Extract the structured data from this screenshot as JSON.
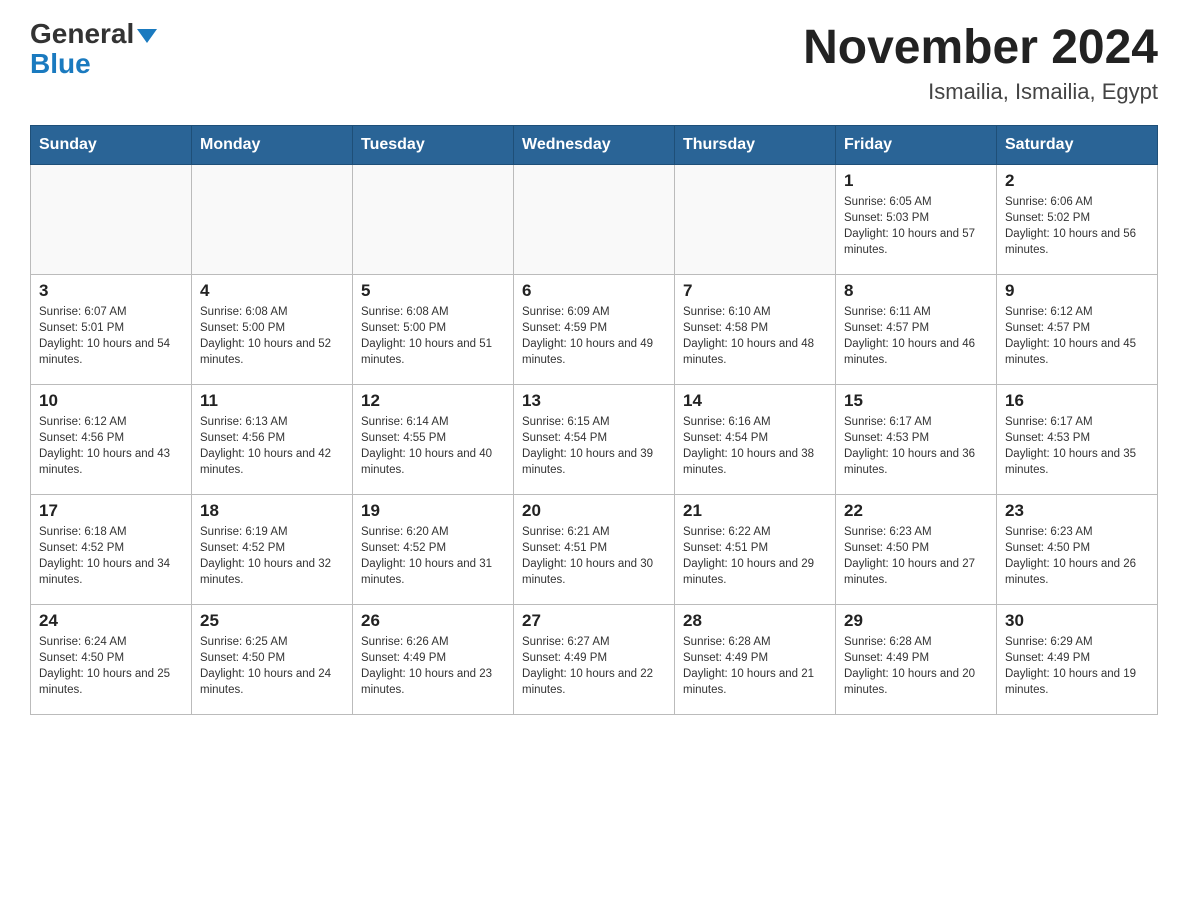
{
  "header": {
    "logo": {
      "general": "General",
      "triangle": "▶",
      "blue": "Blue"
    },
    "title": "November 2024",
    "subtitle": "Ismailia, Ismailia, Egypt"
  },
  "days_of_week": [
    "Sunday",
    "Monday",
    "Tuesday",
    "Wednesday",
    "Thursday",
    "Friday",
    "Saturday"
  ],
  "weeks": [
    [
      {
        "day": "",
        "info": ""
      },
      {
        "day": "",
        "info": ""
      },
      {
        "day": "",
        "info": ""
      },
      {
        "day": "",
        "info": ""
      },
      {
        "day": "",
        "info": ""
      },
      {
        "day": "1",
        "info": "Sunrise: 6:05 AM\nSunset: 5:03 PM\nDaylight: 10 hours and 57 minutes."
      },
      {
        "day": "2",
        "info": "Sunrise: 6:06 AM\nSunset: 5:02 PM\nDaylight: 10 hours and 56 minutes."
      }
    ],
    [
      {
        "day": "3",
        "info": "Sunrise: 6:07 AM\nSunset: 5:01 PM\nDaylight: 10 hours and 54 minutes."
      },
      {
        "day": "4",
        "info": "Sunrise: 6:08 AM\nSunset: 5:00 PM\nDaylight: 10 hours and 52 minutes."
      },
      {
        "day": "5",
        "info": "Sunrise: 6:08 AM\nSunset: 5:00 PM\nDaylight: 10 hours and 51 minutes."
      },
      {
        "day": "6",
        "info": "Sunrise: 6:09 AM\nSunset: 4:59 PM\nDaylight: 10 hours and 49 minutes."
      },
      {
        "day": "7",
        "info": "Sunrise: 6:10 AM\nSunset: 4:58 PM\nDaylight: 10 hours and 48 minutes."
      },
      {
        "day": "8",
        "info": "Sunrise: 6:11 AM\nSunset: 4:57 PM\nDaylight: 10 hours and 46 minutes."
      },
      {
        "day": "9",
        "info": "Sunrise: 6:12 AM\nSunset: 4:57 PM\nDaylight: 10 hours and 45 minutes."
      }
    ],
    [
      {
        "day": "10",
        "info": "Sunrise: 6:12 AM\nSunset: 4:56 PM\nDaylight: 10 hours and 43 minutes."
      },
      {
        "day": "11",
        "info": "Sunrise: 6:13 AM\nSunset: 4:56 PM\nDaylight: 10 hours and 42 minutes."
      },
      {
        "day": "12",
        "info": "Sunrise: 6:14 AM\nSunset: 4:55 PM\nDaylight: 10 hours and 40 minutes."
      },
      {
        "day": "13",
        "info": "Sunrise: 6:15 AM\nSunset: 4:54 PM\nDaylight: 10 hours and 39 minutes."
      },
      {
        "day": "14",
        "info": "Sunrise: 6:16 AM\nSunset: 4:54 PM\nDaylight: 10 hours and 38 minutes."
      },
      {
        "day": "15",
        "info": "Sunrise: 6:17 AM\nSunset: 4:53 PM\nDaylight: 10 hours and 36 minutes."
      },
      {
        "day": "16",
        "info": "Sunrise: 6:17 AM\nSunset: 4:53 PM\nDaylight: 10 hours and 35 minutes."
      }
    ],
    [
      {
        "day": "17",
        "info": "Sunrise: 6:18 AM\nSunset: 4:52 PM\nDaylight: 10 hours and 34 minutes."
      },
      {
        "day": "18",
        "info": "Sunrise: 6:19 AM\nSunset: 4:52 PM\nDaylight: 10 hours and 32 minutes."
      },
      {
        "day": "19",
        "info": "Sunrise: 6:20 AM\nSunset: 4:52 PM\nDaylight: 10 hours and 31 minutes."
      },
      {
        "day": "20",
        "info": "Sunrise: 6:21 AM\nSunset: 4:51 PM\nDaylight: 10 hours and 30 minutes."
      },
      {
        "day": "21",
        "info": "Sunrise: 6:22 AM\nSunset: 4:51 PM\nDaylight: 10 hours and 29 minutes."
      },
      {
        "day": "22",
        "info": "Sunrise: 6:23 AM\nSunset: 4:50 PM\nDaylight: 10 hours and 27 minutes."
      },
      {
        "day": "23",
        "info": "Sunrise: 6:23 AM\nSunset: 4:50 PM\nDaylight: 10 hours and 26 minutes."
      }
    ],
    [
      {
        "day": "24",
        "info": "Sunrise: 6:24 AM\nSunset: 4:50 PM\nDaylight: 10 hours and 25 minutes."
      },
      {
        "day": "25",
        "info": "Sunrise: 6:25 AM\nSunset: 4:50 PM\nDaylight: 10 hours and 24 minutes."
      },
      {
        "day": "26",
        "info": "Sunrise: 6:26 AM\nSunset: 4:49 PM\nDaylight: 10 hours and 23 minutes."
      },
      {
        "day": "27",
        "info": "Sunrise: 6:27 AM\nSunset: 4:49 PM\nDaylight: 10 hours and 22 minutes."
      },
      {
        "day": "28",
        "info": "Sunrise: 6:28 AM\nSunset: 4:49 PM\nDaylight: 10 hours and 21 minutes."
      },
      {
        "day": "29",
        "info": "Sunrise: 6:28 AM\nSunset: 4:49 PM\nDaylight: 10 hours and 20 minutes."
      },
      {
        "day": "30",
        "info": "Sunrise: 6:29 AM\nSunset: 4:49 PM\nDaylight: 10 hours and 19 minutes."
      }
    ]
  ]
}
